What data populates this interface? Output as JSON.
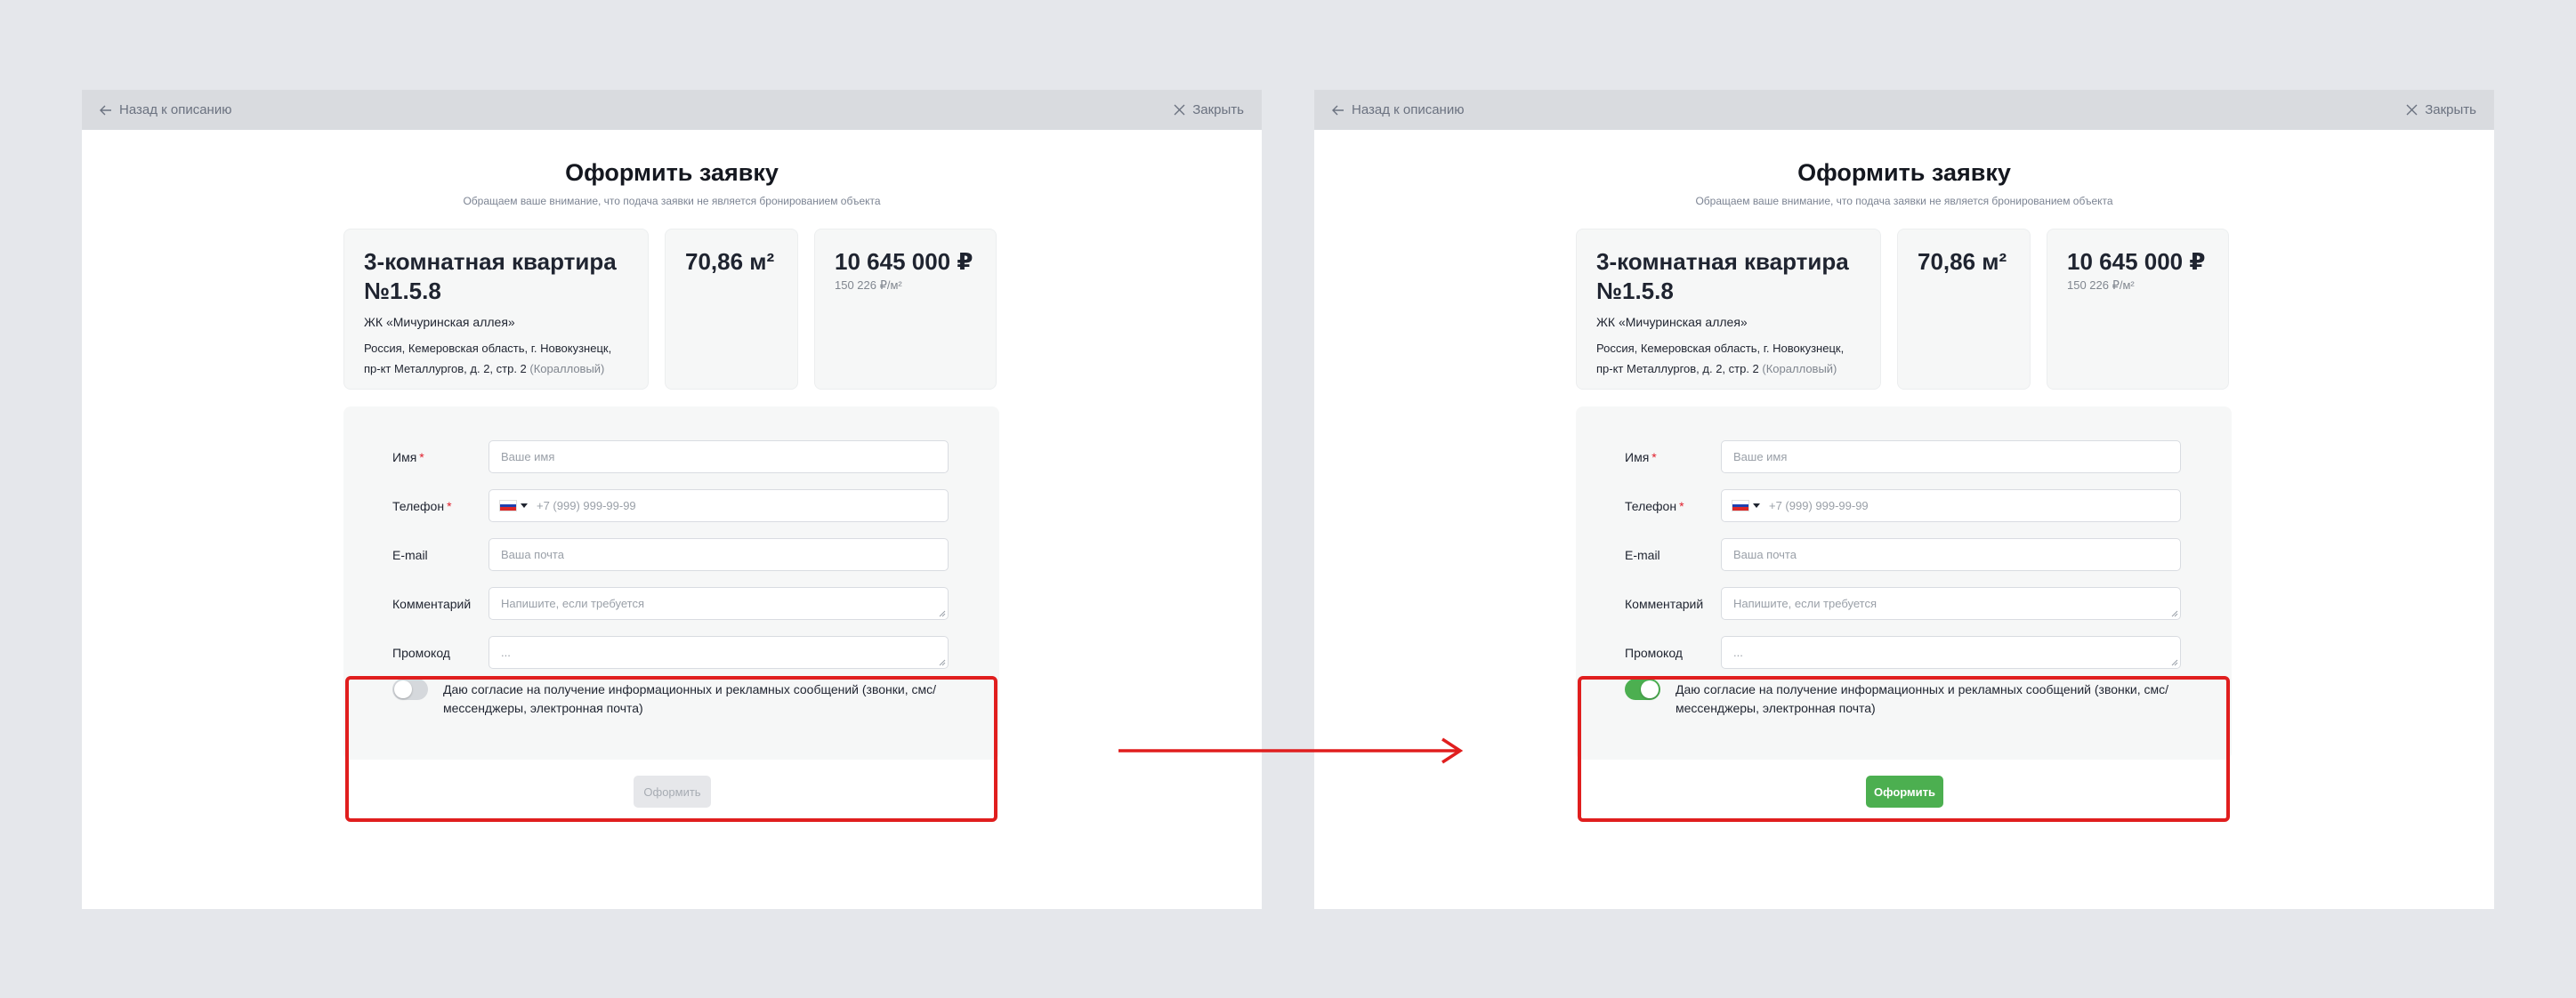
{
  "header": {
    "back_label": "Назад к описанию",
    "close_label": "Закрыть"
  },
  "page": {
    "title": "Оформить заявку",
    "subtitle": "Обращаем ваше внимание, что подача заявки не является бронированием объекта"
  },
  "apartment": {
    "name": "3-комнатная квартира №1.5.8",
    "complex": "ЖК «Мичуринская аллея»",
    "address": "Россия, Кемеровская область, г. Новокузнецк, пр-кт Металлургов, д. 2, стр. 2",
    "district": "(Коралловый)",
    "area": "70,86 м²",
    "price": "10 645 000 ₽",
    "price_per_m2": "150 226 ₽/м²"
  },
  "form": {
    "name": {
      "label": "Имя",
      "placeholder": "Ваше имя"
    },
    "phone": {
      "label": "Телефон",
      "placeholder": "+7 (999) 999-99-99"
    },
    "email": {
      "label": "E-mail",
      "placeholder": "Ваша почта"
    },
    "comment": {
      "label": "Комментарий",
      "placeholder": "Напишите, если требуется"
    },
    "promo": {
      "label": "Промокод",
      "placeholder": "..."
    },
    "required_mark": "*",
    "consent_text": "Даю согласие на получение информационных и рекламных сообщений (звонки, смс/ мессенджеры, электронная почта)",
    "submit_label": "Оформить"
  },
  "states": [
    {
      "consent_on": false,
      "submit_enabled": false
    },
    {
      "consent_on": true,
      "submit_enabled": true
    }
  ],
  "colors": {
    "accent_green": "#4caf50",
    "highlight_red": "#e01e1e",
    "required_red": "#e01e2b",
    "page_background": "#e5e7eb"
  },
  "icons": [
    "arrow-left-icon",
    "close-icon",
    "russia-flag-icon",
    "chevron-down-icon",
    "resize-grip-icon",
    "arrow-right-icon"
  ]
}
